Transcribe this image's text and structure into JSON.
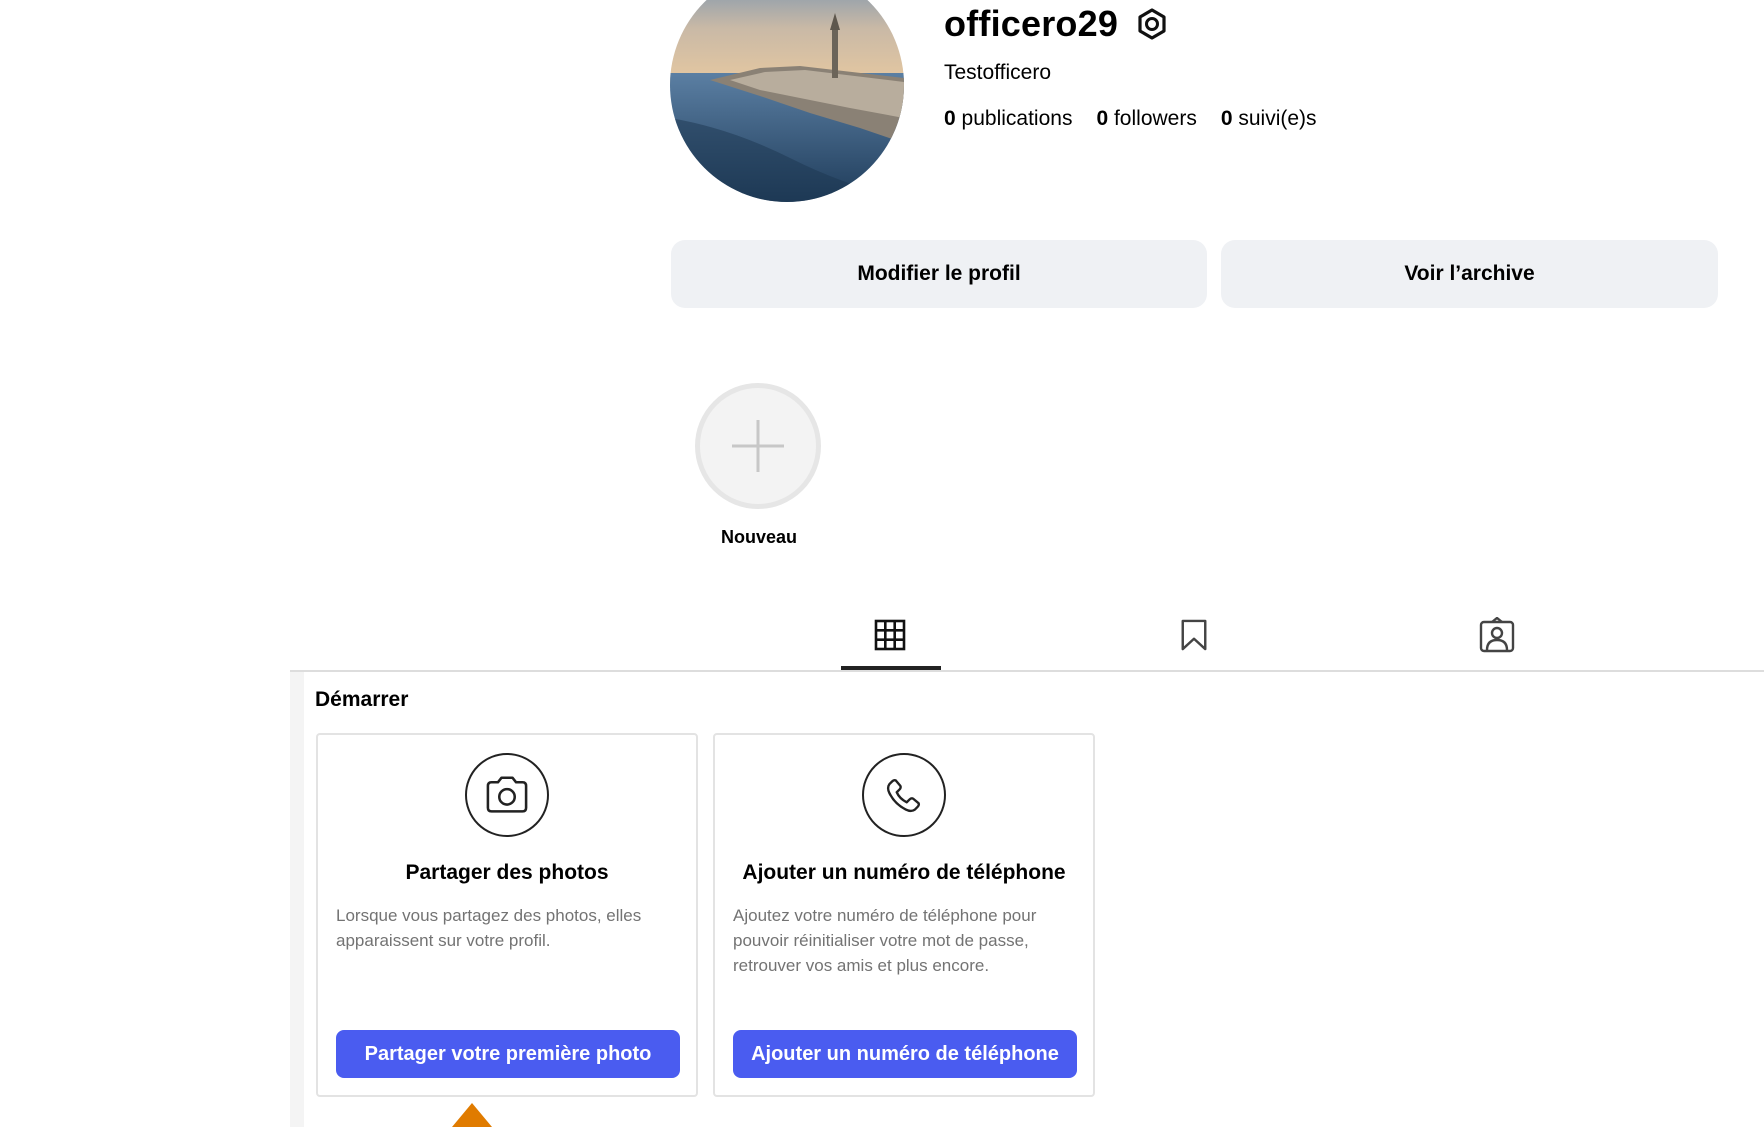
{
  "profile": {
    "username": "officero29",
    "full_name": "Testofficero",
    "stats": [
      {
        "count": "0",
        "label": "publications"
      },
      {
        "count": "0",
        "label": "followers"
      },
      {
        "count": "0",
        "label": "suivi(e)s"
      }
    ],
    "edit_button": "Modifier le profil",
    "archive_button": "Voir l’archive"
  },
  "highlights": {
    "new_label": "Nouveau"
  },
  "tabs": {
    "grid_icon": "grid-icon",
    "saved_icon": "bookmark-icon",
    "tagged_icon": "tagged-icon",
    "active": "grid"
  },
  "get_started": {
    "title": "Démarrer",
    "cards": [
      {
        "icon": "camera-icon",
        "title": "Partager des photos",
        "description": "Lorsque vous partagez des photos, elles apparaissent sur votre profil.",
        "button": "Partager votre première photo"
      },
      {
        "icon": "phone-icon",
        "title": "Ajouter un numéro de téléphone",
        "description": "Ajoutez votre numéro de téléphone pour pouvoir réinitialiser votre mot de passe, retrouver vos amis et plus encore.",
        "button": "Ajouter un numéro de téléphone"
      }
    ]
  },
  "colors": {
    "primary_button": "#4a5cf0",
    "secondary_button": "#eff1f4",
    "cursor": "#e07b00"
  }
}
